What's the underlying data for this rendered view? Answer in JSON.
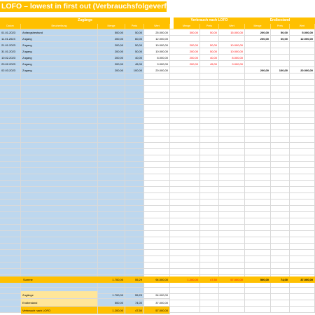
{
  "title": "LOFO – lowest in first out (Verbrauchsfolgeverfahren)",
  "groups": {
    "zugaenge": "Zugänge",
    "verbrauch": "Verbrauch nach LOFO",
    "endbestand": "Endbestand"
  },
  "headers": {
    "datum": "Datum",
    "beschreibung": "Beschreibung",
    "menge": "Menge",
    "preis": "Preis",
    "wert": "Wert",
    "v_menge": "Menge",
    "v_preis": "Preis",
    "v_wert": "Wert",
    "e_menge": "Menge",
    "e_preis": "Preis",
    "e_wert": "Wert"
  },
  "rows": [
    {
      "datum": "01.01.2023",
      "beschreibung": "Anfangsbestand",
      "menge": "500,00",
      "preis": "50,00",
      "wert": "25.000,00",
      "v_menge": "300,00",
      "v_preis": "50,00",
      "v_wert": "15.000,00",
      "e_menge": "200,00",
      "e_preis": "50,00",
      "e_wert": "5.000,00"
    },
    {
      "datum": "11.01.2023",
      "beschreibung": "Zugang",
      "menge": "200,00",
      "preis": "60,00",
      "wert": "12.000,00",
      "v_menge": "",
      "v_preis": "",
      "v_wert": "",
      "e_menge": "200,00",
      "e_preis": "60,00",
      "e_wert": "12.000,00"
    },
    {
      "datum": "21.01.2023",
      "beschreibung": "Zugang",
      "menge": "200,00",
      "preis": "50,00",
      "wert": "10.000,00",
      "v_menge": "200,00",
      "v_preis": "50,00",
      "v_wert": "10.000,00",
      "e_menge": "",
      "e_preis": "",
      "e_wert": ""
    },
    {
      "datum": "31.01.2023",
      "beschreibung": "Zugang",
      "menge": "200,00",
      "preis": "50,00",
      "wert": "10.000,00",
      "v_menge": "200,00",
      "v_preis": "50,00",
      "v_wert": "10.000,00",
      "e_menge": "",
      "e_preis": "",
      "e_wert": ""
    },
    {
      "datum": "10.02.2023",
      "beschreibung": "Zugang",
      "menge": "200,00",
      "preis": "40,00",
      "wert": "8.000,00",
      "v_menge": "200,00",
      "v_preis": "40,00",
      "v_wert": "8.000,00",
      "e_menge": "",
      "e_preis": "",
      "e_wert": ""
    },
    {
      "datum": "20.02.2023",
      "beschreibung": "Zugang",
      "menge": "200,00",
      "preis": "45,00",
      "wert": "9.000,00",
      "v_menge": "200,00",
      "v_preis": "45,00",
      "v_wert": "9.000,00",
      "e_menge": "",
      "e_preis": "",
      "e_wert": ""
    },
    {
      "datum": "02.03.2023",
      "beschreibung": "Zugang",
      "menge": "200,00",
      "preis": "100,00",
      "wert": "20.000,00",
      "v_menge": "",
      "v_preis": "",
      "v_wert": "",
      "e_menge": "200,00",
      "e_preis": "100,00",
      "e_wert": "20.000,00"
    }
  ],
  "empty_rows": 38,
  "sum_row": {
    "label": "Summe",
    "menge": "1.700,00",
    "preis": "55,29",
    "wert": "94.000,00",
    "v_menge": "1.200,00",
    "v_preis": "47,50",
    "v_wert": "57.000,00",
    "e_menge": "500,00",
    "e_preis": "74,00",
    "e_wert": "37.000,00"
  },
  "summary": [
    {
      "label": "Zugänge",
      "menge": "1.700,00",
      "preis": "55,29",
      "wert": "94.000,00"
    },
    {
      "label": "Endbestand",
      "menge": "500,00",
      "preis": "74,00",
      "wert": "37.000,00"
    },
    {
      "label": "Verbrauch nach LOFO",
      "menge": "1.200,00",
      "preis": "47,50",
      "wert": "57.000,00"
    }
  ],
  "colors": {
    "accent": "#ffc000",
    "blue": "#bdd7ee",
    "red": "#ff0000",
    "summary_label_bg": "#ffe699"
  }
}
